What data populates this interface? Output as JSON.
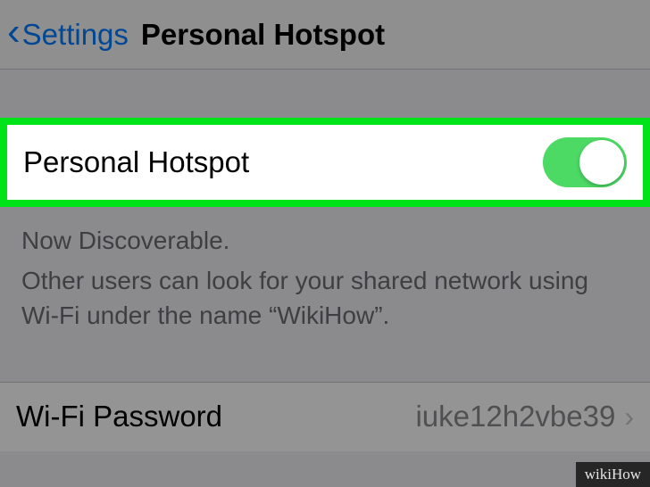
{
  "header": {
    "back_label": "Settings",
    "title": "Personal Hotspot"
  },
  "hotspot_row": {
    "label": "Personal Hotspot",
    "enabled": true
  },
  "description": {
    "line1": "Now Discoverable.",
    "line2": "Other users can look for your shared network using Wi-Fi under the name “WikiHow”."
  },
  "password_row": {
    "label": "Wi-Fi Password",
    "value": "iuke12h2vbe39"
  },
  "watermark": "wikiHow"
}
